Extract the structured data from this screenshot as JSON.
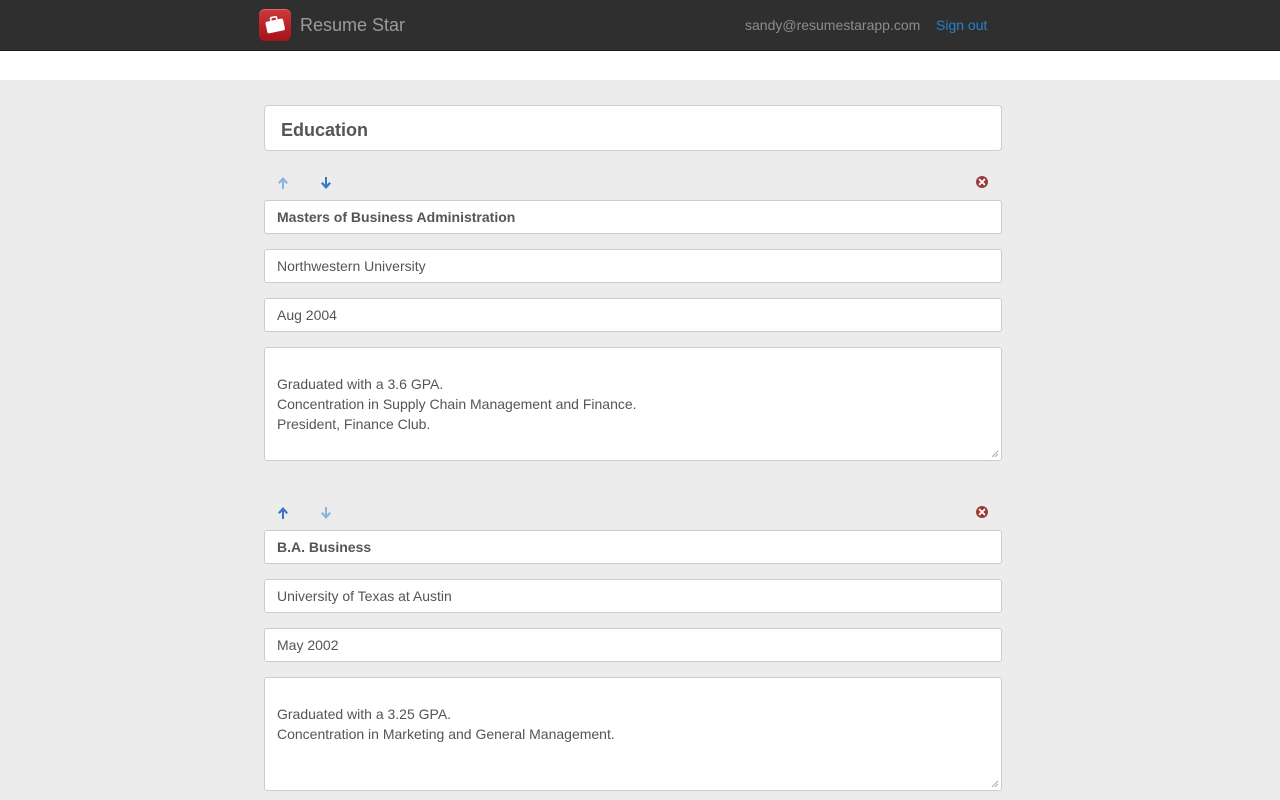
{
  "navbar": {
    "brand": "Resume Star",
    "user_email": "sandy@resumestarapp.com",
    "signout_label": "Sign out"
  },
  "section": {
    "title": "Education"
  },
  "entries": [
    {
      "degree": "Masters of Business Administration",
      "school": "Northwestern University",
      "date": "Aug 2004",
      "description": "Graduated with a 3.6 GPA.\nConcentration in Supply Chain Management and Finance.\nPresident, Finance Club."
    },
    {
      "degree": "B.A. Business",
      "school": "University of Texas at Austin",
      "date": "May 2002",
      "description": "Graduated with a 3.25 GPA.\nConcentration in Marketing and General Management."
    }
  ],
  "icons": {
    "logo": "briefcase-icon",
    "move_up": "arrow-up-icon",
    "move_down": "arrow-down-icon",
    "remove": "remove-circle-icon"
  },
  "colors": {
    "navbar_bg": "#2f2f2f",
    "link": "#2a7fd0",
    "arrow_active": "#3a78c3",
    "arrow_disabled": "#8fb2da",
    "remove": "#9b3b3b",
    "page_bg": "#ececec"
  }
}
